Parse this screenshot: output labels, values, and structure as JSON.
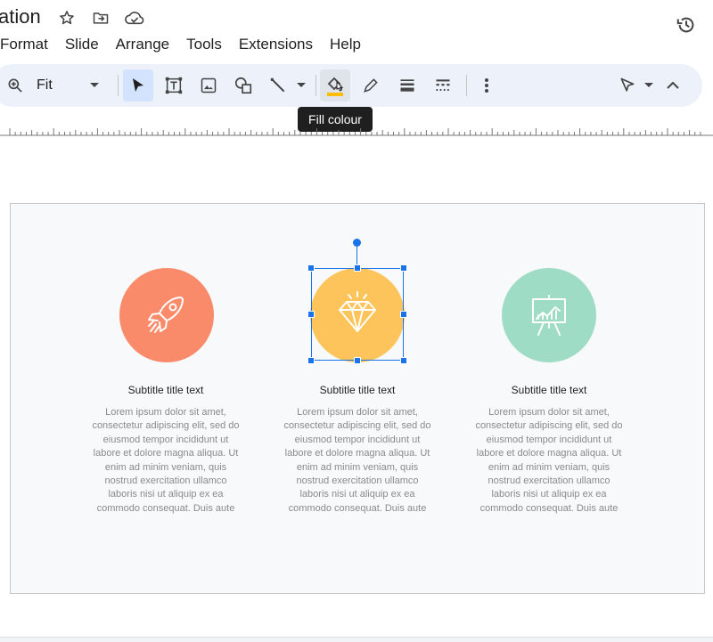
{
  "app": {
    "doc_title": "ation",
    "icons": [
      "star-icon",
      "move-folder-icon",
      "cloud-saved-icon",
      "version-history-icon"
    ]
  },
  "menu": {
    "items": [
      "Format",
      "Slide",
      "Arrange",
      "Tools",
      "Extensions",
      "Help"
    ]
  },
  "toolbar": {
    "zoom_value": "Fit",
    "tooltip": "Fill colour",
    "colors": {
      "accent_active": "#d3e3fd",
      "fill_swatch": "#fbbc04",
      "bg": "#edf2fa"
    }
  },
  "slide": {
    "columns": [
      {
        "icon": "rocket-icon",
        "circle_color": "#f98b6b",
        "subtitle": "Subtitle title text",
        "body": "Lorem ipsum dolor sit amet, consectetur adipiscing elit, sed do eiusmod tempor incididunt ut labore et dolore magna aliqua. Ut enim ad minim veniam, quis nostrud exercitation ullamco laboris nisi ut aliquip ex ea commodo consequat. Duis aute"
      },
      {
        "icon": "diamond-icon",
        "circle_color": "#fcc45a",
        "subtitle": "Subtitle title text",
        "body": "Lorem ipsum dolor sit amet, consectetur adipiscing elit, sed do eiusmod tempor incididunt ut labore et dolore magna aliqua. Ut enim ad minim veniam, quis nostrud exercitation ullamco laboris nisi ut aliquip ex ea commodo consequat. Duis aute"
      },
      {
        "icon": "presentation-chart-icon",
        "circle_color": "#9fdcc5",
        "subtitle": "Subtitle title text",
        "body": "Lorem ipsum dolor sit amet, consectetur adipiscing elit, sed do eiusmod tempor incididunt ut labore et dolore magna aliqua. Ut enim ad minim veniam, quis nostrud exercitation ullamco laboris nisi ut aliquip ex ea commodo consequat. Duis aute"
      }
    ],
    "selection_color": "#1a73e8"
  }
}
